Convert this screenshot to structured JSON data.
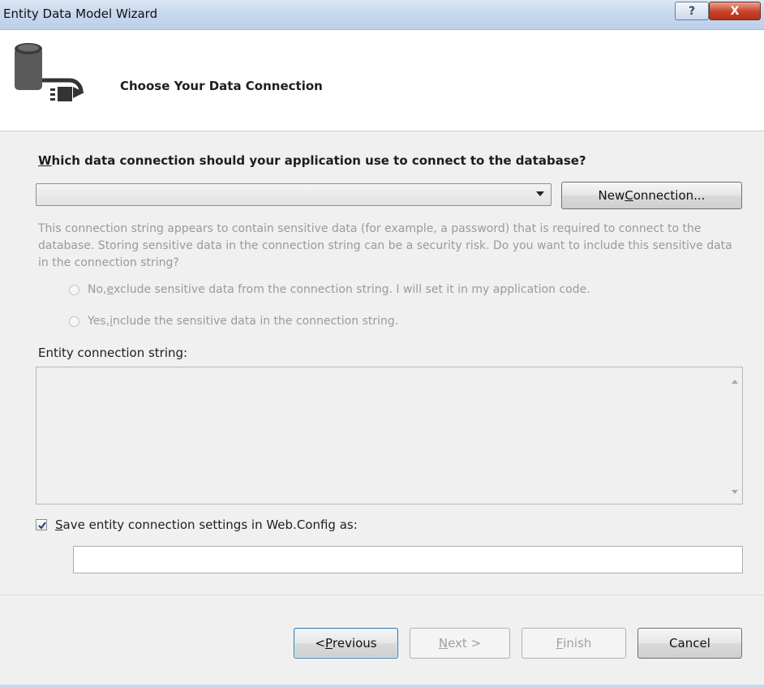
{
  "window": {
    "title": "Entity Data Model Wizard",
    "help_glyph": "?",
    "close_glyph": "X"
  },
  "header": {
    "heading": "Choose Your Data Connection",
    "icon": "database-plug-icon"
  },
  "connection": {
    "question_first_letter": "W",
    "question_rest": "hich data connection should your application use to connect to the database?",
    "selected_value": "",
    "new_connection_prefix": "New ",
    "new_connection_mnemonic": "C",
    "new_connection_suffix": "onnection..."
  },
  "sensitive": {
    "message": "This connection string appears to contain sensitive data (for example, a password) that is required to connect to the database. Storing sensitive data in the connection string can be a security risk. Do you want to include this sensitive data in the connection string?",
    "option_no_prefix": "No, ",
    "option_no_mnemonic": "e",
    "option_no_suffix": "xclude sensitive data from the connection string. I will set it in my application code.",
    "option_yes_prefix": "Yes, ",
    "option_yes_mnemonic": "i",
    "option_yes_suffix": "nclude the sensitive data in the connection string."
  },
  "entity_connection": {
    "label": "Entity connection string:",
    "value": ""
  },
  "save_settings": {
    "checked": true,
    "label_mnemonic": "S",
    "label_rest": "ave entity connection settings in Web.Config as:",
    "value": ""
  },
  "footer": {
    "previous_prefix": "< ",
    "previous_mnemonic": "P",
    "previous_suffix": "revious",
    "next_mnemonic": "N",
    "next_suffix": "ext >",
    "finish_mnemonic": "F",
    "finish_suffix": "inish",
    "cancel_label": "Cancel"
  }
}
